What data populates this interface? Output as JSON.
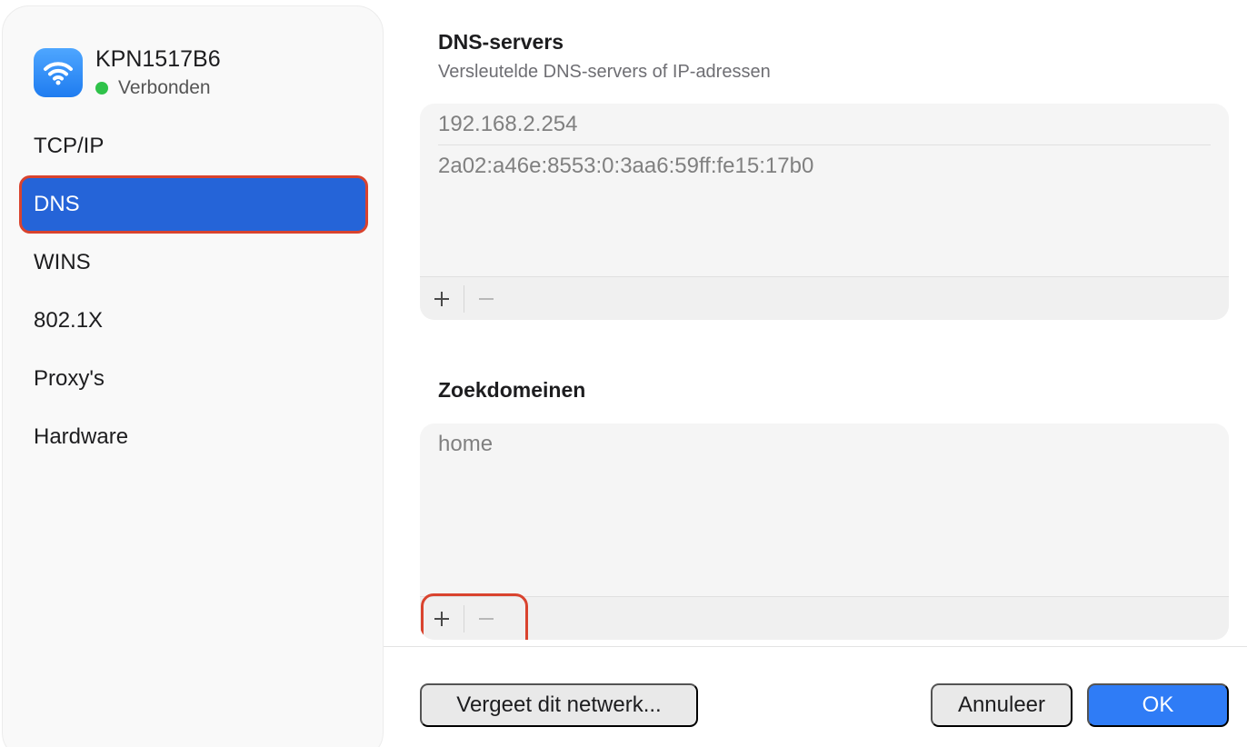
{
  "network": {
    "name": "KPN1517B6",
    "status": "Verbonden",
    "status_color": "#2fc24a",
    "icon": "wifi-icon"
  },
  "sidebar": {
    "items": [
      {
        "label": "TCP/IP",
        "active": false
      },
      {
        "label": "DNS",
        "active": true
      },
      {
        "label": "WINS",
        "active": false
      },
      {
        "label": "802.1X",
        "active": false
      },
      {
        "label": "Proxy's",
        "active": false
      },
      {
        "label": "Hardware",
        "active": false
      }
    ]
  },
  "dns": {
    "title": "DNS-servers",
    "subtitle": "Versleutelde DNS-servers of IP-adressen",
    "servers": [
      "192.168.2.254",
      "2a02:a46e:8553:0:3aa6:59ff:fe15:17b0"
    ],
    "add_label": "+",
    "remove_label": "−"
  },
  "search_domains": {
    "title": "Zoekdomeinen",
    "domains": [
      "home"
    ],
    "add_label": "+",
    "remove_label": "−"
  },
  "footer": {
    "forget_label": "Vergeet dit netwerk...",
    "cancel_label": "Annuleer",
    "ok_label": "OK"
  },
  "colors": {
    "accent": "#2564d8",
    "ok_button": "#2f7cf6",
    "highlight": "#d9432e"
  }
}
